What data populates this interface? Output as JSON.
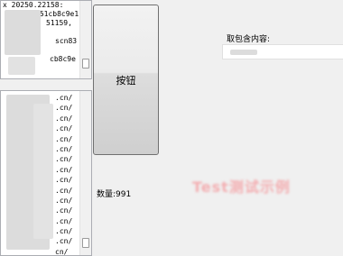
{
  "top_list": {
    "lines": [
      "x 20250.22158:",
      "251cb8c9e1",
      "51159,",
      "",
      "scn83",
      "",
      "cb8c9e"
    ]
  },
  "bottom_list": {
    "lines": [
      ".cn/",
      ".cn/",
      ".cn/",
      ".cn/",
      ".cn/",
      ".cn/",
      ".cn/",
      ".cn/",
      ".cn/",
      ".cn/",
      ".cn/",
      ".cn/",
      ".cn/",
      ".cn/",
      ".cn/",
      "cn/"
    ]
  },
  "button": {
    "label": "按钮"
  },
  "count": {
    "label": "数量:991"
  },
  "content": {
    "label": "取包含内容:",
    "value": ""
  },
  "watermark": {
    "text": "Test测试示例"
  }
}
